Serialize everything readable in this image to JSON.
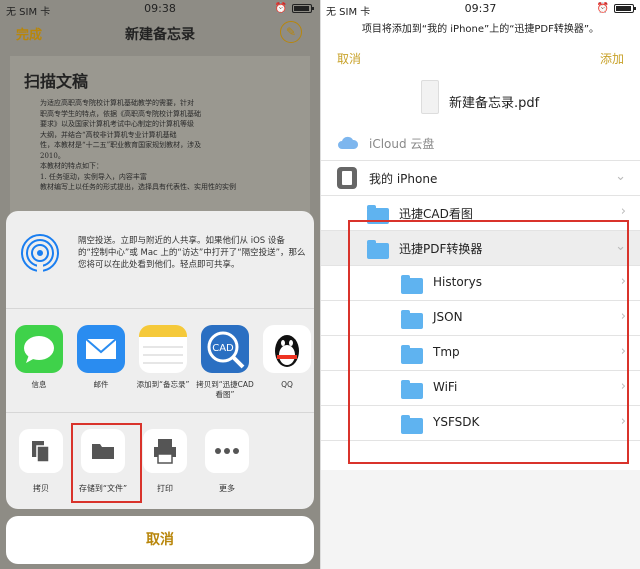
{
  "left": {
    "status": {
      "carrier": "无 SIM 卡",
      "time": "09:38"
    },
    "nav": {
      "done": "完成",
      "title": "新建备忘录"
    },
    "document": {
      "title": "扫描文稿",
      "lines": [
        "为适应高职高专院校计算机基础教学的需要，针对",
        "职高专学生的特点，依据《高职高专院校计算机基础",
        "要求》以及国家计算机考试中心制定的计算机等级",
        "大纲，并结合“高校非计算机专业计算机基础",
        "性，本教材是“十二五”职业教育国家规划教材，涉及",
        "2010。",
        "本教材的特点如下：",
        "1. 任务驱动，实例导入，内容丰富",
        "教材编写上以任务的形式提出，选择具有代表性、实用性的实例"
      ]
    },
    "airdrop": {
      "text": "隔空投送。立即与附近的人共享。如果他们从 iOS 设备的“控制中心”或 Mac 上的“访达”中打开了“隔空投送”，那么您将可以在此处看到他们。轻点即可共享。"
    },
    "apps": [
      {
        "label": "信息"
      },
      {
        "label": "邮件"
      },
      {
        "label": "添加到“备忘录”"
      },
      {
        "label": "拷贝到“迅捷CAD看图”"
      },
      {
        "label": "QQ"
      }
    ],
    "actions": [
      {
        "label": "拷贝"
      },
      {
        "label": "存储到“文件”"
      },
      {
        "label": "打印"
      },
      {
        "label": "更多"
      }
    ],
    "cancel": "取消",
    "cad_text": "CAD"
  },
  "right": {
    "status": {
      "carrier": "无 SIM 卡",
      "time": "09:37"
    },
    "message": "项目将添加到“我的 iPhone”上的“迅捷PDF转换器”。",
    "nav": {
      "cancel": "取消",
      "add": "添加"
    },
    "file_name": "新建备忘录.pdf",
    "locations": [
      {
        "label": "iCloud 云盘"
      },
      {
        "label": "我的 iPhone"
      }
    ],
    "folders": [
      {
        "label": "迅捷CAD看图"
      },
      {
        "label": "迅捷PDF转换器"
      }
    ],
    "subfolders": [
      {
        "label": "Historys"
      },
      {
        "label": "JSON"
      },
      {
        "label": "Tmp"
      },
      {
        "label": "WiFi"
      },
      {
        "label": "YSFSDK"
      }
    ]
  },
  "colors": {
    "accent": "#b8860b",
    "folder": "#5fb3f0",
    "highlight": "#d9332b"
  }
}
